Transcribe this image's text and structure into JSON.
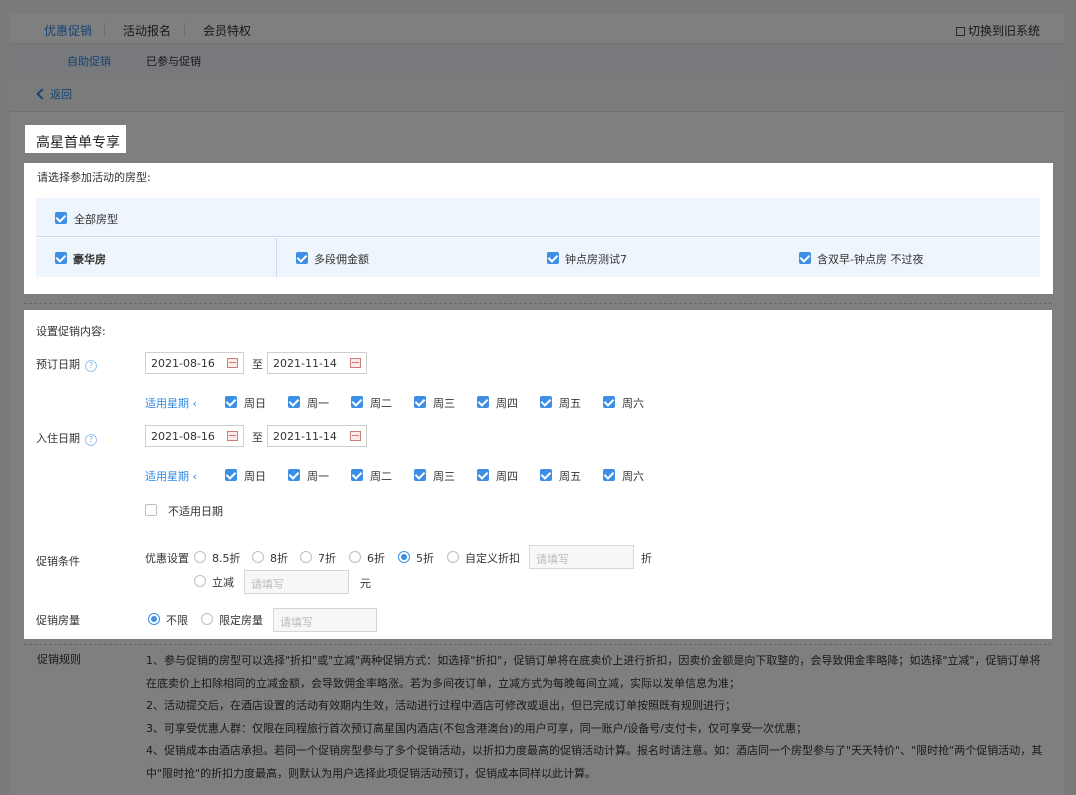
{
  "topnav": {
    "tabs": [
      "优惠促销",
      "活动报名",
      "会员特权"
    ],
    "switch_label": "切换到旧系统"
  },
  "subnav": {
    "tabs": [
      "自助促销",
      "已参与促销"
    ]
  },
  "back_label": "返回",
  "title": "高星首单专享",
  "rooms": {
    "label": "请选择参加活动的房型:",
    "all_label": "全部房型",
    "items": [
      "豪华房",
      "多段佣金额",
      "钟点房测试7",
      "含双早-钟点房 不过夜"
    ]
  },
  "promo": {
    "section_label": "设置促销内容:",
    "booking_label": "预订日期",
    "checkin_label": "入住日期",
    "help_icon": "?",
    "start_date": "2021-08-16",
    "end_date": "2021-11-14",
    "to_label": "至",
    "weekdays_label": "适用星期",
    "weekdays": [
      "周日",
      "周一",
      "周二",
      "周三",
      "周四",
      "周五",
      "周六"
    ],
    "not_applicable_label": "不适用日期",
    "condition_label": "促销条件",
    "discount_setting_label": "优惠设置",
    "discount_options": [
      "8.5折",
      "8折",
      "7折",
      "6折",
      "5折",
      "自定义折扣"
    ],
    "selected_discount": "5折",
    "discount_unit": "折",
    "reduce_label": "立减",
    "reduce_unit": "元",
    "placeholder": "请填写",
    "room_qty_label": "促销房量",
    "room_qty_options": [
      "不限",
      "限定房量"
    ],
    "selected_room_qty": "不限"
  },
  "rules": {
    "label": "促销规则",
    "lines": [
      "1、参与促销的房型可以选择\"折扣\"或\"立减\"两种促销方式：如选择\"折扣\"，促销订单将在底卖价上进行折扣，因卖价金额是向下取整的，会导致佣金率略降；如选择\"立减\"，促销订单将在底卖价上扣除相同的立减金额，会导致佣金率略涨。若为多间夜订单，立减方式为每晚每间立减，实际以发单信息为准；",
      "2、活动提交后，在酒店设置的活动有效期内生效，活动进行过程中酒店可修改或退出，但已完成订单按照既有规则进行；",
      "3、可享受优惠人群：仅限在同程旅行首次预订高星国内酒店(不包含港澳台)的用户可享，同一账户/设备号/支付卡，仅可享受一次优惠；",
      "4、促销成本由酒店承担。若同一个促销房型参与了多个促销活动，以折扣力度最高的促销活动计算。报名时请注意。如：酒店同一个房型参与了\"天天特价\"、\"限时抢\"两个促销活动，其中\"限时抢\"的折扣力度最高，则默认为用户选择此项促销活动预订，促销成本同样以此计算。"
    ]
  }
}
